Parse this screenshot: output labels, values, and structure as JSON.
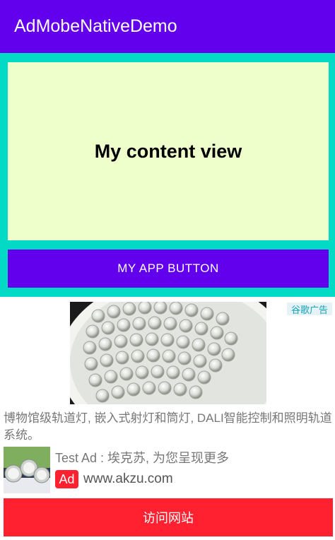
{
  "app_bar": {
    "title": "AdMobeNativeDemo"
  },
  "content": {
    "label": "My content view"
  },
  "app_button": {
    "label": "MY APP BUTTON"
  },
  "ad": {
    "tag": "谷歌广告",
    "image_icon": "led-light-image",
    "body": "博物馆级轨道灯, 嵌入式射灯和筒灯, DALI智能控制和照明轨道系统。",
    "headline": "Test Ad : 埃克苏, 为您呈现更多",
    "badge": "Ad",
    "url": "www.akzu.com",
    "cta": "访问网站",
    "colors": {
      "cta": "#ff2030",
      "badge": "#ff2030",
      "tag_text": "#17a2b8"
    }
  },
  "colors": {
    "primary": "#6200ee",
    "secondary": "#03dac5",
    "content_bg": "#eeffcc"
  }
}
